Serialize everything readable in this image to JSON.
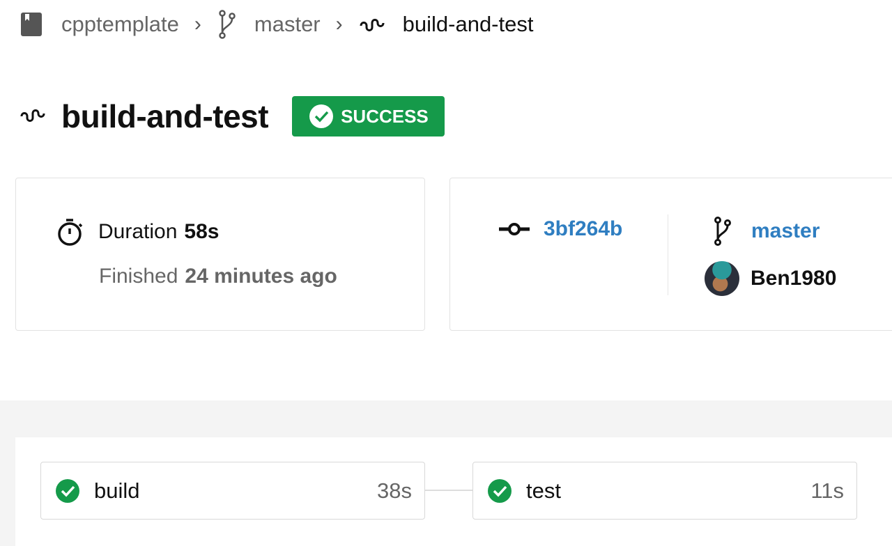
{
  "breadcrumb": {
    "repo": "cpptemplate",
    "branch": "master",
    "pipeline": "build-and-test"
  },
  "header": {
    "title": "build-and-test",
    "status": "SUCCESS"
  },
  "summary": {
    "duration_label": "Duration",
    "duration": "58s",
    "finished_label": "Finished",
    "finished": "24 minutes ago"
  },
  "commit": {
    "sha": "3bf264b",
    "branch": "master",
    "author": "Ben1980"
  },
  "steps": [
    {
      "name": "build",
      "duration": "38s"
    },
    {
      "name": "test",
      "duration": "11s"
    }
  ],
  "colors": {
    "success": "#159a4a",
    "link": "#2f7ec1"
  }
}
